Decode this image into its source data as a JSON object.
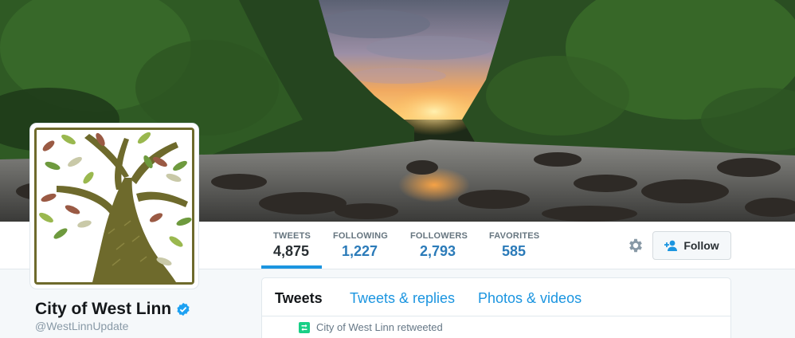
{
  "profile": {
    "name": "City of West Linn",
    "handle": "@WestLinnUpdate",
    "verified": true
  },
  "stats": [
    {
      "label": "TWEETS",
      "value": "4,875",
      "active": true
    },
    {
      "label": "FOLLOWING",
      "value": "1,227",
      "active": false
    },
    {
      "label": "FOLLOWERS",
      "value": "2,793",
      "active": false
    },
    {
      "label": "FAVORITES",
      "value": "585",
      "active": false
    }
  ],
  "actions": {
    "settings_icon": "gear-icon",
    "follow_label": "Follow",
    "follow_icon": "add-user-icon"
  },
  "timeline": {
    "tabs": [
      {
        "label": "Tweets",
        "active": true
      },
      {
        "label": "Tweets & replies",
        "active": false
      },
      {
        "label": "Photos & videos",
        "active": false
      }
    ],
    "retweet_notice": "City of West Linn retweeted",
    "retweet_icon": "retweet-icon"
  },
  "colors": {
    "link_blue": "#1b95e0",
    "verified_blue": "#1da1f2",
    "retweet_green": "#19cf86",
    "tree_olive": "#6e6a2c"
  }
}
